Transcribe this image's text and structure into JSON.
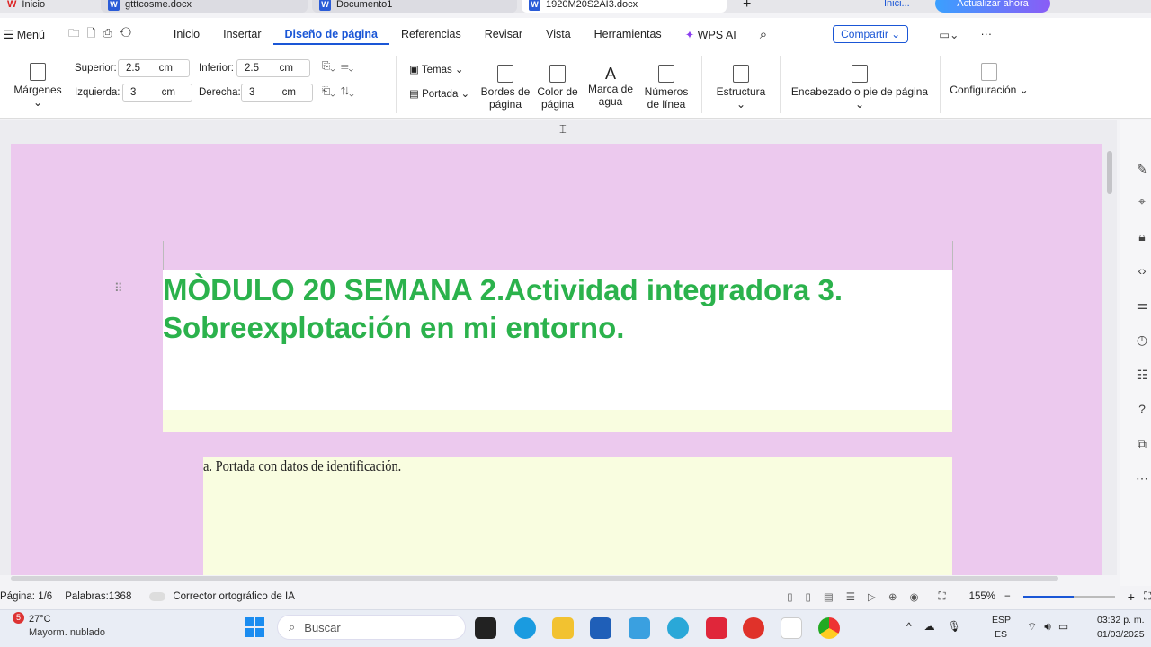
{
  "tabs": [
    {
      "label": "Inicio"
    },
    {
      "label": "gtttcosme.docx"
    },
    {
      "label": "Documento1"
    },
    {
      "label": "1920M20S2AI3.docx"
    }
  ],
  "window": {
    "account_label": "Inici...",
    "upgrade_button": "Actualizar ahora",
    "new_tab": "+"
  },
  "menu": {
    "menu_label": "Menú",
    "items": [
      "Inicio",
      "Insertar",
      "Diseño de página",
      "Referencias",
      "Revisar",
      "Vista",
      "Herramientas"
    ],
    "active": "Diseño de página",
    "wps_ai": "WPS AI",
    "share": "Compartir"
  },
  "ribbon": {
    "margins": "Márgenes",
    "top_label": "Superior:",
    "top_value": "2.5",
    "bottom_label": "Inferior:",
    "bottom_value": "2.5",
    "left_label": "Izquierda:",
    "left_value": "3",
    "right_label": "Derecha:",
    "right_value": "3",
    "unit": "cm",
    "themes": "Temas",
    "cover": "Portada",
    "page_borders": "Bordes de página",
    "page_color": "Color de página",
    "watermark": "Marca de agua",
    "line_numbers": "Números de línea",
    "structure": "Estructura",
    "header_footer": "Encabezado o pie de página",
    "settings": "Configuración"
  },
  "document": {
    "title": "MÒDULO 20 SEMANA 2.Actividad integradora 3. Sobreexplotación en mi entorno.",
    "item_a": "a. Portada con datos de identificación.",
    "title_color": "#2bb24c",
    "page_color": "#ecc9ee"
  },
  "status": {
    "page": "Página: 1/6",
    "words": "Palabras:1368",
    "spell": "Corrector ortográfico de IA",
    "zoom": "155%",
    "zoom_fraction": 0.55
  },
  "taskbar": {
    "weather_temp": "27°C",
    "weather_desc": "Mayorm. nublado",
    "weather_badge": "5",
    "search": "Buscar",
    "lang1": "ESP",
    "lang2": "ES",
    "time": "03:32 p. m.",
    "date": "01/03/2025"
  }
}
